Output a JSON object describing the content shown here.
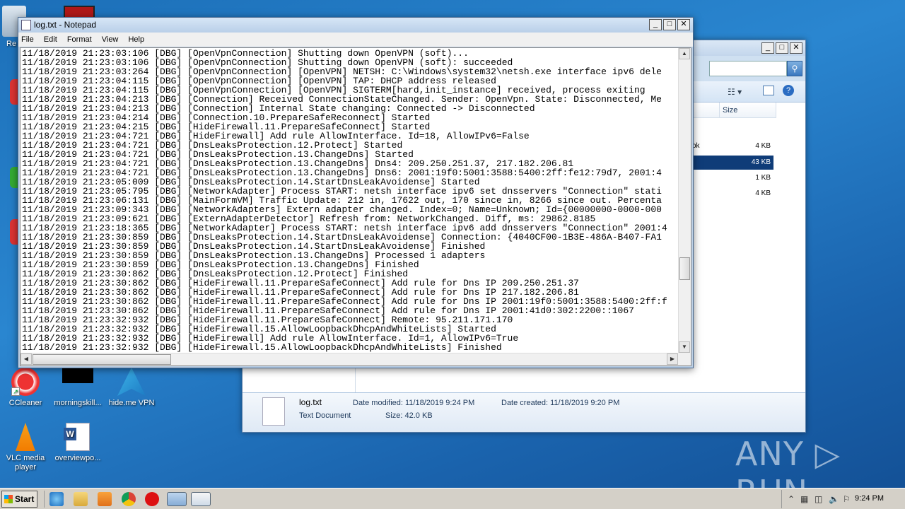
{
  "desktop": {
    "icons": [
      {
        "label": "Re",
        "name": "recycle-bin"
      },
      {
        "label": "CCleaner",
        "name": "ccleaner"
      },
      {
        "label": "morningskill...",
        "name": "morningskill"
      },
      {
        "label": "hide.me VPN",
        "name": "hideme-vpn"
      },
      {
        "label": "VLC media player",
        "name": "vlc"
      },
      {
        "label": "overviewpo...",
        "name": "overviewpo"
      }
    ],
    "watermark": "ANY ▷ RUN"
  },
  "explorer": {
    "size_header": "Size",
    "rows": [
      {
        "name_tail": "ok",
        "size": "4 KB",
        "selected": false
      },
      {
        "name_tail": "",
        "size": "43 KB",
        "selected": true
      },
      {
        "name_tail": "",
        "size": "1 KB",
        "selected": false
      },
      {
        "name_tail": "",
        "size": "4 KB",
        "selected": false
      }
    ],
    "details": {
      "filename": "log.txt",
      "filetype": "Text Document",
      "date_modified": "Date modified: 11/18/2019 9:24 PM",
      "date_created": "Date created: 11/18/2019 9:20 PM",
      "size": "Size: 42.0 KB"
    }
  },
  "notepad": {
    "title": "log.txt - Notepad",
    "menu": [
      "File",
      "Edit",
      "Format",
      "View",
      "Help"
    ],
    "lines": [
      "11/18/2019 21:23:03:106 [DBG] [OpenVpnConnection] Shutting down OpenVPN (soft)...",
      "11/18/2019 21:23:03:106 [DBG] [OpenVpnConnection] Shutting down OpenVPN (soft): succeeded",
      "11/18/2019 21:23:03:264 [DBG] [OpenVpnConnection] [OpenVPN] NETSH: C:\\Windows\\system32\\netsh.exe interface ipv6 dele",
      "11/18/2019 21:23:04:115 [DBG] [OpenVpnConnection] [OpenVPN] TAP: DHCP address released",
      "11/18/2019 21:23:04:115 [DBG] [OpenVpnConnection] [OpenVPN] SIGTERM[hard,init_instance] received, process exiting",
      "11/18/2019 21:23:04:213 [DBG] [Connection] Received ConnectionStateChanged. Sender: OpenVpn. State: Disconnected, Me",
      "11/18/2019 21:23:04:213 [DBG] [Connection] Internal State changing: Connected -> Disconnected",
      "11/18/2019 21:23:04:214 [DBG] [Connection.10.PrepareSafeReconnect] Started",
      "11/18/2019 21:23:04:215 [DBG] [HideFirewall.11.PrepareSafeConnect] Started",
      "11/18/2019 21:23:04:721 [DBG] [HideFirewall] Add rule AllowInterface. Id=18, AllowIPv6=False",
      "11/18/2019 21:23:04:721 [DBG] [DnsLeaksProtection.12.Protect] Started",
      "11/18/2019 21:23:04:721 [DBG] [DnsLeaksProtection.13.ChangeDns] Started",
      "11/18/2019 21:23:04:721 [DBG] [DnsLeaksProtection.13.ChangeDns] Dns4: 209.250.251.37, 217.182.206.81",
      "11/18/2019 21:23:04:721 [DBG] [DnsLeaksProtection.13.ChangeDns] Dns6: 2001:19f0:5001:3588:5400:2ff:fe12:79d7, 2001:4",
      "11/18/2019 21:23:05:009 [DBG] [DnsLeaksProtection.14.StartDnsLeakAvoidense] Started",
      "11/18/2019 21:23:05:795 [DBG] [NetworkAdapter] Process START: netsh interface ipv6 set dnsservers \"Connection\" stati",
      "11/18/2019 21:23:06:131 [DBG] [MainFormVM] Traffic Update: 212 in, 17622 out, 170 since in, 8266 since out. Percenta",
      "11/18/2019 21:23:09:343 [DBG] [NetworkAdapters] Extern adapter changed. Index=0; Name=Unknown; Id={00000000-0000-000",
      "11/18/2019 21:23:09:621 [DBG] [ExternAdapterDetector] Refresh from: NetworkChanged. Diff, ms: 29862.8185",
      "11/18/2019 21:23:18:365 [DBG] [NetworkAdapter] Process START: netsh interface ipv6 add dnsservers \"Connection\" 2001:4",
      "11/18/2019 21:23:30:859 [DBG] [DnsLeaksProtection.14.StartDnsLeakAvoidense] Connection: {4040CF00-1B3E-486A-B407-FA1",
      "11/18/2019 21:23:30:859 [DBG] [DnsLeaksProtection.14.StartDnsLeakAvoidense] Finished",
      "11/18/2019 21:23:30:859 [DBG] [DnsLeaksProtection.13.ChangeDns] Processed 1 adapters",
      "11/18/2019 21:23:30:859 [DBG] [DnsLeaksProtection.13.ChangeDns] Finished",
      "11/18/2019 21:23:30:862 [DBG] [DnsLeaksProtection.12.Protect] Finished",
      "11/18/2019 21:23:30:862 [DBG] [HideFirewall.11.PrepareSafeConnect] Add rule for Dns IP 209.250.251.37",
      "11/18/2019 21:23:30:862 [DBG] [HideFirewall.11.PrepareSafeConnect] Add rule for Dns IP 217.182.206.81",
      "11/18/2019 21:23:30:862 [DBG] [HideFirewall.11.PrepareSafeConnect] Add rule for Dns IP 2001:19f0:5001:3588:5400:2ff:f",
      "11/18/2019 21:23:30:862 [DBG] [HideFirewall.11.PrepareSafeConnect] Add rule for Dns IP 2001:41d0:302:2200::1067",
      "11/18/2019 21:23:32:932 [DBG] [HideFirewall.11.PrepareSafeConnect] Remote: 95.211.171.170",
      "11/18/2019 21:23:32:932 [DBG] [HideFirewall.15.AllowLoopbackDhcpAndWhiteLists] Started",
      "11/18/2019 21:23:32:932 [DBG] [HideFirewall] Add rule AllowInterface. Id=1, AllowIPv6=True",
      "11/18/2019 21:23:32:932 [DBG] [HideFirewall.15.AllowLoopbackDhcpAndWhiteLists] Finished"
    ]
  },
  "taskbar": {
    "start_label": "Start",
    "clock": "9:24 PM"
  }
}
